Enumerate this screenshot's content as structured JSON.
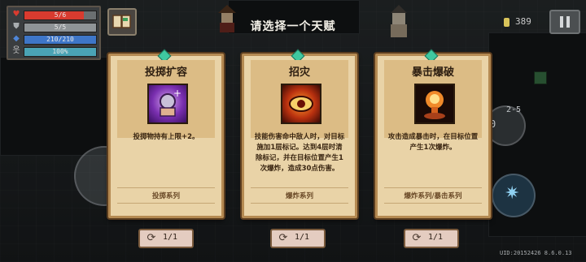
{
  "status": {
    "hp": {
      "text": "5/6",
      "ratio": 0.83,
      "color": "#d93b2f"
    },
    "armor": {
      "text": "5/5",
      "ratio": 1.0,
      "color": "#8f9497"
    },
    "energy": {
      "text": "210/210",
      "ratio": 1.0,
      "color": "#3e76c8"
    },
    "skill": {
      "text": "100%",
      "ratio": 1.0,
      "color": "#4aa3b5"
    }
  },
  "title": "请选择一个天赋",
  "coins": "389",
  "cards": [
    {
      "name": "投掷扩容",
      "desc": "投掷物持有上限+2。",
      "tag": "投掷系列",
      "reroll": "1/1"
    },
    {
      "name": "招灾",
      "desc": "技能伤害命中敌人时，对目标施加1层标记。达到4层时清除标记，并在目标位置产生1次爆炸，造成30点伤害。",
      "tag": "爆炸系列",
      "reroll": "1/1"
    },
    {
      "name": "暴击爆破",
      "desc": "攻击造成暴击时，在目标位置产生1次爆炸。",
      "tag": "爆炸系列/暴击系列",
      "reroll": "1/1"
    }
  ],
  "skill_counter": "2-5",
  "skill_left": "0",
  "uid": "UID:20152426  8.6.0.13",
  "icons": {
    "heart": "heart-icon",
    "shield": "shield-icon",
    "energy": "energy-crystal-icon",
    "skill": "skill-figure-icon",
    "book": "talent-book-icon",
    "pause": "pause-icon",
    "coin": "coin-icon",
    "reroll": "reroll-icon"
  }
}
